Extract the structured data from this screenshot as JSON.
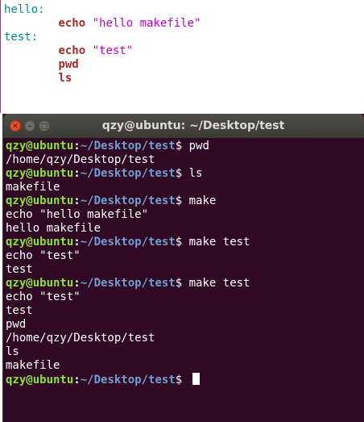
{
  "editor": {
    "lines": [
      {
        "target": "hello:"
      },
      {
        "cmd": "echo",
        "str": "\"hello makefile\""
      },
      {
        "target": "test:"
      },
      {
        "cmd": "echo",
        "str": "\"test\""
      },
      {
        "cmd": "pwd"
      },
      {
        "cmd": "ls"
      }
    ]
  },
  "terminal": {
    "title": "qzy@ubuntu: ~/Desktop/test",
    "prompt": {
      "user": "qzy@ubuntu",
      "sep": ":",
      "path": "~/Desktop/test",
      "dollar": "$"
    },
    "lines": [
      {
        "type": "prompt",
        "cmd": "pwd"
      },
      {
        "type": "out",
        "text": "/home/qzy/Desktop/test"
      },
      {
        "type": "prompt",
        "cmd": "ls"
      },
      {
        "type": "out",
        "text": "makefile"
      },
      {
        "type": "prompt",
        "cmd": "make"
      },
      {
        "type": "out",
        "text": "echo \"hello makefile\""
      },
      {
        "type": "out",
        "text": "hello makefile"
      },
      {
        "type": "prompt",
        "cmd": "make test"
      },
      {
        "type": "out",
        "text": "echo \"test\""
      },
      {
        "type": "out",
        "text": "test"
      },
      {
        "type": "prompt",
        "cmd": "make test"
      },
      {
        "type": "out",
        "text": "echo \"test\""
      },
      {
        "type": "out",
        "text": "test"
      },
      {
        "type": "out",
        "text": "pwd"
      },
      {
        "type": "out",
        "text": "/home/qzy/Desktop/test"
      },
      {
        "type": "out",
        "text": "ls"
      },
      {
        "type": "out",
        "text": "makefile"
      },
      {
        "type": "prompt",
        "cmd": ""
      }
    ]
  },
  "colors": {
    "terminal_bg": "#300a24",
    "prompt_user": "#8ae234",
    "prompt_path": "#729fcf",
    "editor_target": "#008b8b",
    "editor_cmd": "#a52a2a",
    "editor_string": "#c000c0"
  },
  "icons": [
    "close-icon",
    "minimize-icon",
    "maximize-icon"
  ]
}
